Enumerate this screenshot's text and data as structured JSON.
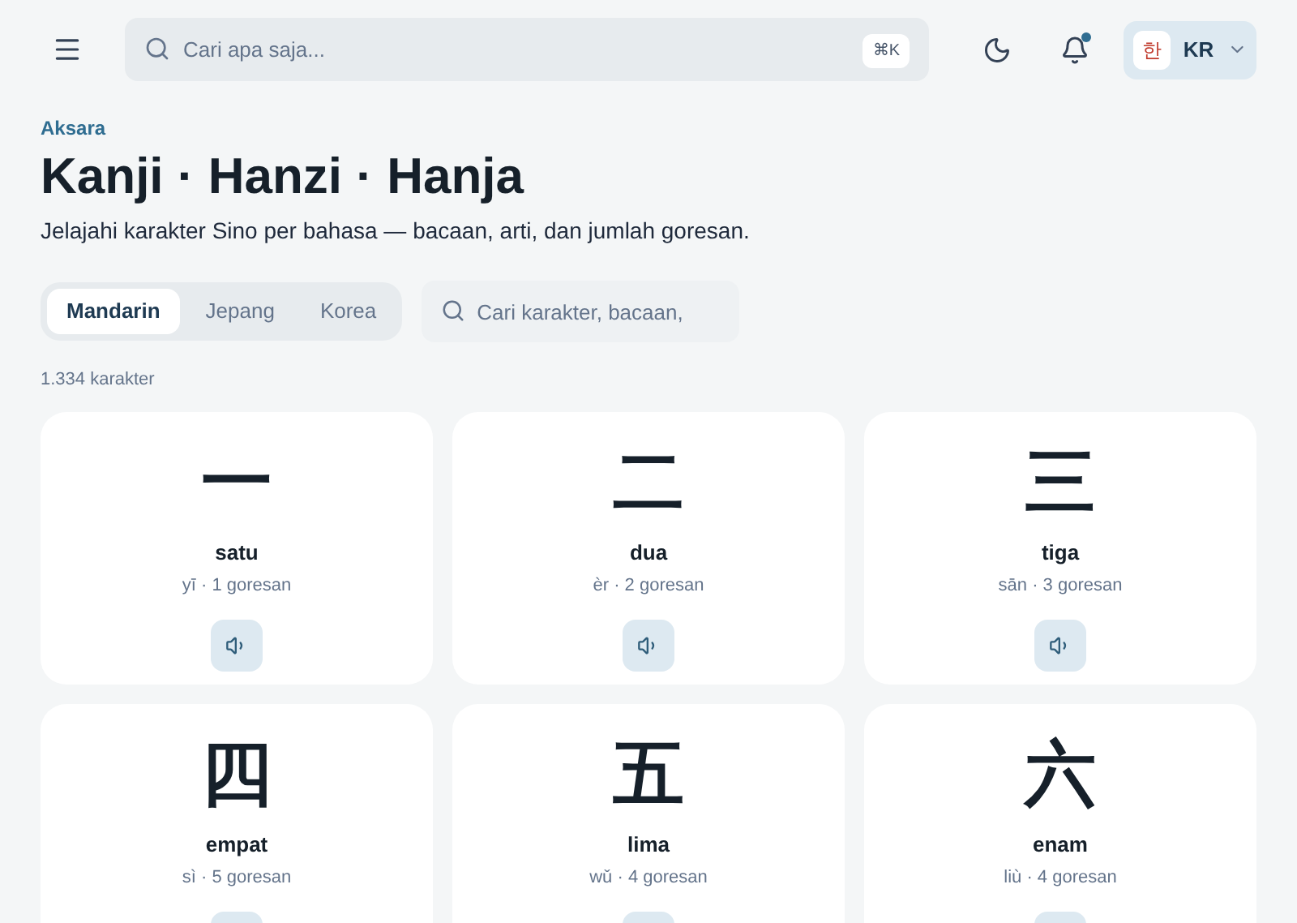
{
  "header": {
    "search": {
      "placeholder": "Cari apa saja...",
      "shortcut": "⌘K"
    },
    "language": {
      "glyph": "한",
      "code": "KR"
    }
  },
  "page": {
    "eyebrow": "Aksara",
    "title": "Kanji · Hanzi · Hanja",
    "subtitle": "Jelajahi karakter Sino per bahasa — bacaan, arti, dan jumlah goresan."
  },
  "tabs": [
    {
      "label": "Mandarin",
      "selected": true
    },
    {
      "label": "Jepang",
      "selected": false
    },
    {
      "label": "Korea",
      "selected": false
    }
  ],
  "filter": {
    "placeholder": "Cari karakter, bacaan,"
  },
  "count": "1.334 karakter",
  "cards": [
    {
      "character": "一",
      "meaning": "satu",
      "detail": "yī · 1 goresan"
    },
    {
      "character": "二",
      "meaning": "dua",
      "detail": "èr · 2 goresan"
    },
    {
      "character": "三",
      "meaning": "tiga",
      "detail": "sān · 3 goresan"
    },
    {
      "character": "四",
      "meaning": "empat",
      "detail": "sì · 5 goresan"
    },
    {
      "character": "五",
      "meaning": "lima",
      "detail": "wǔ · 4 goresan"
    },
    {
      "character": "六",
      "meaning": "enam",
      "detail": "liù · 4 goresan"
    }
  ]
}
